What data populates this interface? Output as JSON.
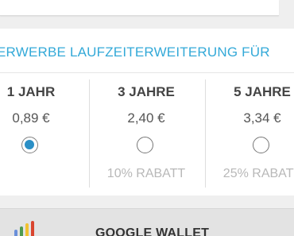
{
  "purchase": {
    "title": "ERWERBE LAUFZEITERWEITERUNG FÜR",
    "options": [
      {
        "period": "1 JAHR",
        "price": "0,89 €",
        "selected": true,
        "discount": ""
      },
      {
        "period": "3 JAHRE",
        "price": "2,40 €",
        "selected": false,
        "discount": "10% RABATT"
      },
      {
        "period": "5 JAHRE",
        "price": "3,34 €",
        "selected": false,
        "discount": "25% RABATT"
      }
    ]
  },
  "payment": {
    "method_label": "GOOGLE WALLET",
    "icon": "google-wallet-icon"
  },
  "colors": {
    "accent": "#33a9d8",
    "radio_selected": "#2a8fc6",
    "discount_text": "#b8b8b8"
  }
}
